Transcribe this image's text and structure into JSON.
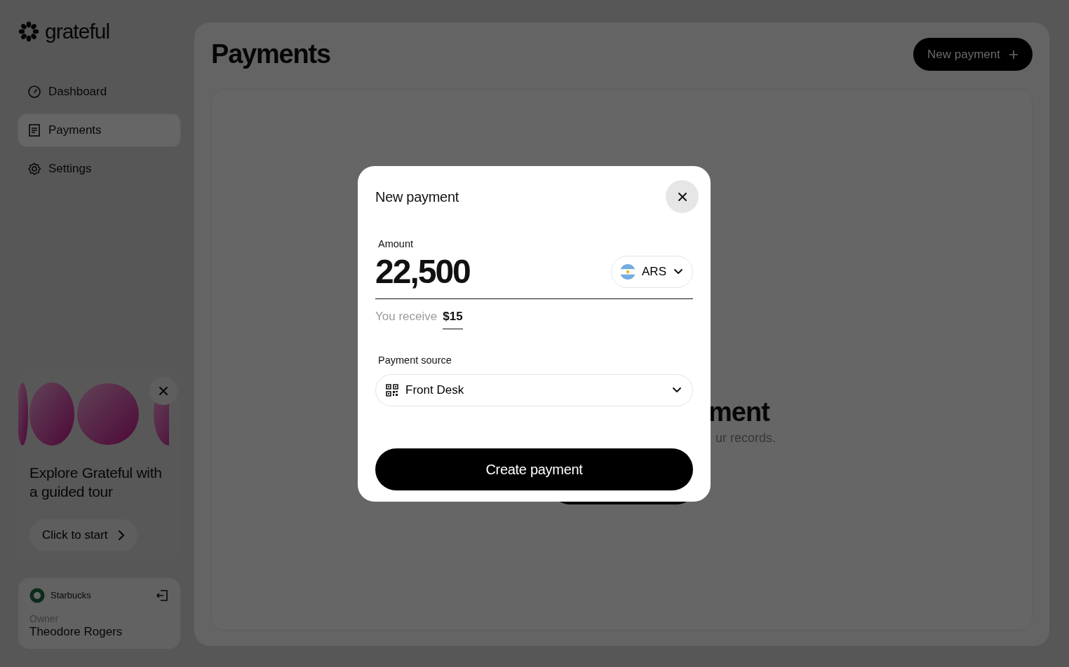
{
  "sidebar": {
    "logo": "grateful",
    "items": [
      {
        "label": "Dashboard",
        "kind": "dashboard",
        "selected": false
      },
      {
        "label": "Payments",
        "kind": "payments",
        "selected": true
      },
      {
        "label": "Settings",
        "kind": "settings",
        "selected": false
      }
    ],
    "tour": {
      "title": "Explore Grateful with a guided tour",
      "button": "Click to start"
    },
    "account": {
      "company": "Starbucks",
      "role": "Owner",
      "name": "Theodore Rogers"
    }
  },
  "main": {
    "title": "Payments",
    "new_button": "New payment",
    "empty_state": {
      "heading": "ment",
      "text": "ur records."
    }
  },
  "dialog": {
    "title": "New payment",
    "amount_label": "Amount",
    "amount": "22,500",
    "currency": "ARS",
    "receive_label": "You receive",
    "receive_value": "$15",
    "source_label": "Payment source",
    "source": "Front Desk",
    "submit": "Create payment"
  }
}
